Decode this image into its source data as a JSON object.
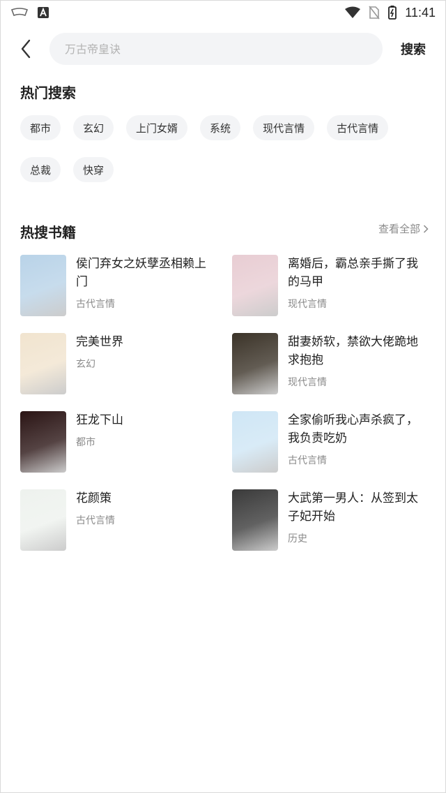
{
  "status_bar": {
    "time": "11:41",
    "icons": [
      "app-notification-icon",
      "android-debug-icon",
      "wifi-icon",
      "no-sim-icon",
      "battery-icon"
    ]
  },
  "search": {
    "placeholder": "万古帝皇诀",
    "button_label": "搜索",
    "back_icon": "chevron-left-icon"
  },
  "hot_search": {
    "title": "热门搜索",
    "tags": [
      "都市",
      "玄幻",
      "上门女婿",
      "系统",
      "现代言情",
      "古代言情",
      "总裁",
      "快穿"
    ]
  },
  "hot_books": {
    "title": "热搜书籍",
    "view_all_label": "查看全部",
    "books": [
      {
        "title": "侯门弃女之妖孽丞相赖上门",
        "category": "古代言情",
        "cover_color": "#b9d3e8"
      },
      {
        "title": "离婚后，霸总亲手撕了我的马甲",
        "category": "现代言情",
        "cover_color": "#e8cdd3"
      },
      {
        "title": "完美世界",
        "category": "玄幻",
        "cover_color": "#f1e4cf"
      },
      {
        "title": "甜妻娇软，禁欲大佬跪地求抱抱",
        "category": "现代言情",
        "cover_color": "#3b3328"
      },
      {
        "title": "狂龙下山",
        "category": "都市",
        "cover_color": "#2a1414"
      },
      {
        "title": "全家偷听我心声杀疯了，我负责吃奶",
        "category": "古代言情",
        "cover_color": "#cfe6f5"
      },
      {
        "title": "花颜策",
        "category": "古代言情",
        "cover_color": "#eef2ee"
      },
      {
        "title": "大武第一男人：从签到太子妃开始",
        "category": "历史",
        "cover_color": "#3a3a3a"
      }
    ]
  }
}
